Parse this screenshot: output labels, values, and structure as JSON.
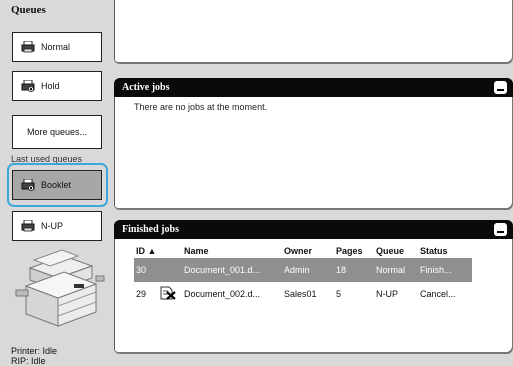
{
  "sidebar": {
    "title": "Queues",
    "queues": [
      {
        "label": "Normal",
        "icon": "printer-icon"
      },
      {
        "label": "Hold",
        "icon": "printer-hold-icon"
      }
    ],
    "more_label": "More queues...",
    "last_used_label": "Last used queues",
    "last_used": [
      {
        "label": "Booklet",
        "icon": "printer-hold-icon",
        "selected": true
      },
      {
        "label": "N-UP",
        "icon": "printer-icon",
        "selected": false
      }
    ],
    "status": [
      "Printer: Idle",
      "RIP: Idle"
    ]
  },
  "active_jobs": {
    "title": "Active jobs",
    "empty_message": "There are no jobs at the moment."
  },
  "finished_jobs": {
    "title": "Finished jobs",
    "columns": {
      "id": "ID ▲",
      "name": "Name",
      "owner": "Owner",
      "pages": "Pages",
      "queue": "Queue",
      "status": "Status"
    },
    "rows": [
      {
        "id": "30",
        "icon": "",
        "name": "Document_001.d...",
        "owner": "Admin",
        "pages": "18",
        "queue": "Normal",
        "status": "Finish...",
        "selected": true
      },
      {
        "id": "29",
        "icon": "cancelled-job-icon",
        "name": "Document_002.d...",
        "owner": "Sales01",
        "pages": "5",
        "queue": "N-UP",
        "status": "Cancel...",
        "selected": false
      }
    ]
  },
  "colors": {
    "panel_bar": "#0a0a0a",
    "selected_row": "#8f8f8f",
    "selected_queue": "#a7a7a7",
    "focus_ring": "#3aa9d9"
  }
}
